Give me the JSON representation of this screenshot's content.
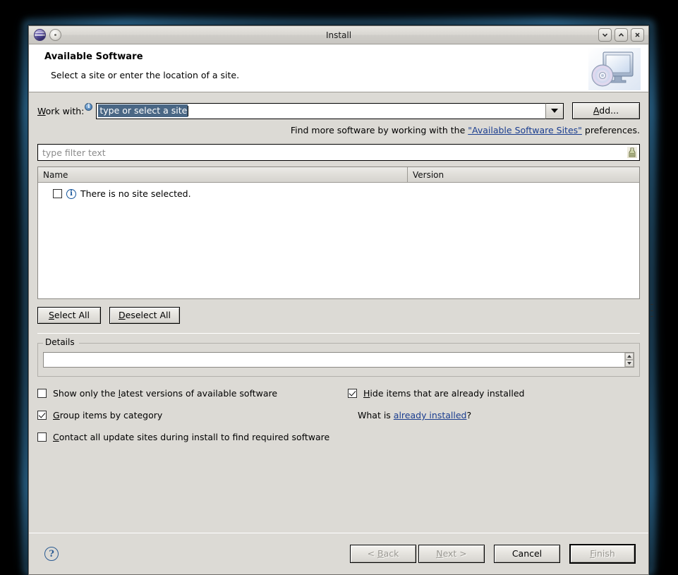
{
  "window": {
    "title": "Install",
    "app_icon": "eclipse-globe-icon",
    "menu_icon": "window-menu-icon",
    "controls": {
      "minimize": "minimize-icon",
      "maximize": "maximize-icon",
      "close": "close-icon"
    }
  },
  "header": {
    "title": "Available Software",
    "subtitle": "Select a site or enter the location of a site.",
    "graphic": "install-monitor-disc-icon"
  },
  "work_with": {
    "label_prefix": "W",
    "label_rest": "ork with:",
    "info_icon": "info-icon",
    "value": "type or select a site",
    "placeholder": "type or select a site",
    "dropdown_icon": "chevron-down-icon",
    "add_button": {
      "mnemonic": "A",
      "rest": "dd..."
    }
  },
  "find_more": {
    "before": "Find more software by working with the ",
    "link": "\"Available Software Sites\"",
    "after": " preferences."
  },
  "filter": {
    "placeholder": "type filter text",
    "icon": "filter-icon"
  },
  "table": {
    "columns": [
      "Name",
      "Version"
    ],
    "rows": [
      {
        "checked": false,
        "icon": "info-icon",
        "name": "There is no site selected.",
        "version": ""
      }
    ]
  },
  "selection_buttons": {
    "select_all": {
      "mnemonic": "S",
      "rest": "elect All"
    },
    "deselect_all": {
      "mnemonic": "D",
      "rest": "eselect All"
    }
  },
  "details": {
    "legend": "Details",
    "text": "",
    "scroll_up_icon": "scroll-up-icon",
    "scroll_down_icon": "scroll-down-icon"
  },
  "options": {
    "left": [
      {
        "checked": false,
        "pre": "Show only the ",
        "mnemonic": "l",
        "post": "atest versions of available software"
      },
      {
        "checked": true,
        "pre": "",
        "mnemonic": "G",
        "post": "roup items by category"
      },
      {
        "checked": false,
        "pre": "",
        "mnemonic": "C",
        "post": "ontact all update sites during install to find required software"
      }
    ],
    "right": [
      {
        "checked": true,
        "pre": "",
        "mnemonic": "H",
        "post": "ide items that are already installed"
      }
    ],
    "note": {
      "before": "What is ",
      "link": "already installed",
      "after": "?"
    }
  },
  "footer": {
    "help_icon": "help-icon",
    "back": {
      "pre": "< ",
      "mnemonic": "B",
      "post": "ack",
      "enabled": false
    },
    "next": {
      "pre": "",
      "mnemonic": "N",
      "post": "ext >",
      "enabled": false
    },
    "cancel": {
      "pre": "Cancel",
      "mnemonic": "",
      "post": "",
      "enabled": true
    },
    "finish": {
      "pre": "",
      "mnemonic": "F",
      "post": "inish",
      "enabled": false,
      "is_default": true
    }
  },
  "colors": {
    "desktop": "#000000",
    "window_bg": "#dcdad5",
    "glow": "#3c8cbe",
    "selection": "#4a6785",
    "link": "#1a3d8f",
    "info_blue": "#15559b",
    "disabled_text": "#9a9892"
  }
}
